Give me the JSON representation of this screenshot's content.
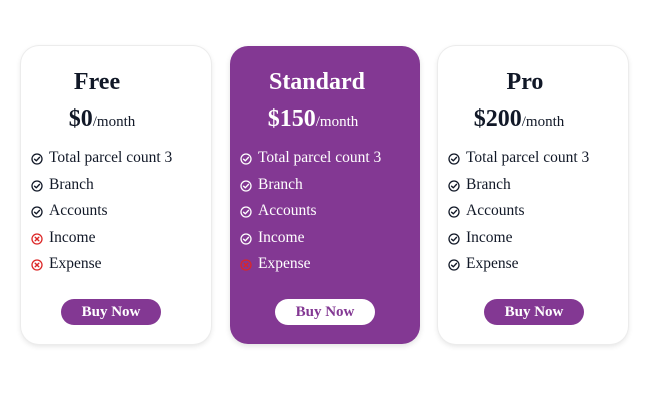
{
  "colors": {
    "accent": "#833893",
    "text": "#111827",
    "included_icon_light": "#111827",
    "included_icon_dark": "#ffffff",
    "excluded_icon": "#dc2626"
  },
  "plans": [
    {
      "name": "Free",
      "price": "$0",
      "period": "/month",
      "featured": false,
      "button_label": "Buy Now",
      "features": [
        {
          "label": "Total parcel count 3",
          "icon": "check-circle-icon",
          "included": true
        },
        {
          "label": "Branch",
          "icon": "check-circle-icon",
          "included": true
        },
        {
          "label": "Accounts",
          "icon": "check-circle-icon",
          "included": true
        },
        {
          "label": "Income",
          "icon": "x-circle-icon",
          "included": false
        },
        {
          "label": "Expense",
          "icon": "x-circle-icon",
          "included": false
        }
      ]
    },
    {
      "name": "Standard",
      "price": "$150",
      "period": "/month",
      "featured": true,
      "button_label": "Buy Now",
      "features": [
        {
          "label": "Total parcel count 3",
          "icon": "check-circle-icon",
          "included": true
        },
        {
          "label": "Branch",
          "icon": "check-circle-icon",
          "included": true
        },
        {
          "label": "Accounts",
          "icon": "check-circle-icon",
          "included": true
        },
        {
          "label": "Income",
          "icon": "check-circle-icon",
          "included": true
        },
        {
          "label": "Expense",
          "icon": "x-circle-icon",
          "included": false
        }
      ]
    },
    {
      "name": "Pro",
      "price": "$200",
      "period": "/month",
      "featured": false,
      "button_label": "Buy Now",
      "features": [
        {
          "label": "Total parcel count 3",
          "icon": "check-circle-icon",
          "included": true
        },
        {
          "label": "Branch",
          "icon": "check-circle-icon",
          "included": true
        },
        {
          "label": "Accounts",
          "icon": "check-circle-icon",
          "included": true
        },
        {
          "label": "Income",
          "icon": "check-circle-icon",
          "included": true
        },
        {
          "label": "Expense",
          "icon": "check-circle-icon",
          "included": true
        }
      ]
    }
  ]
}
